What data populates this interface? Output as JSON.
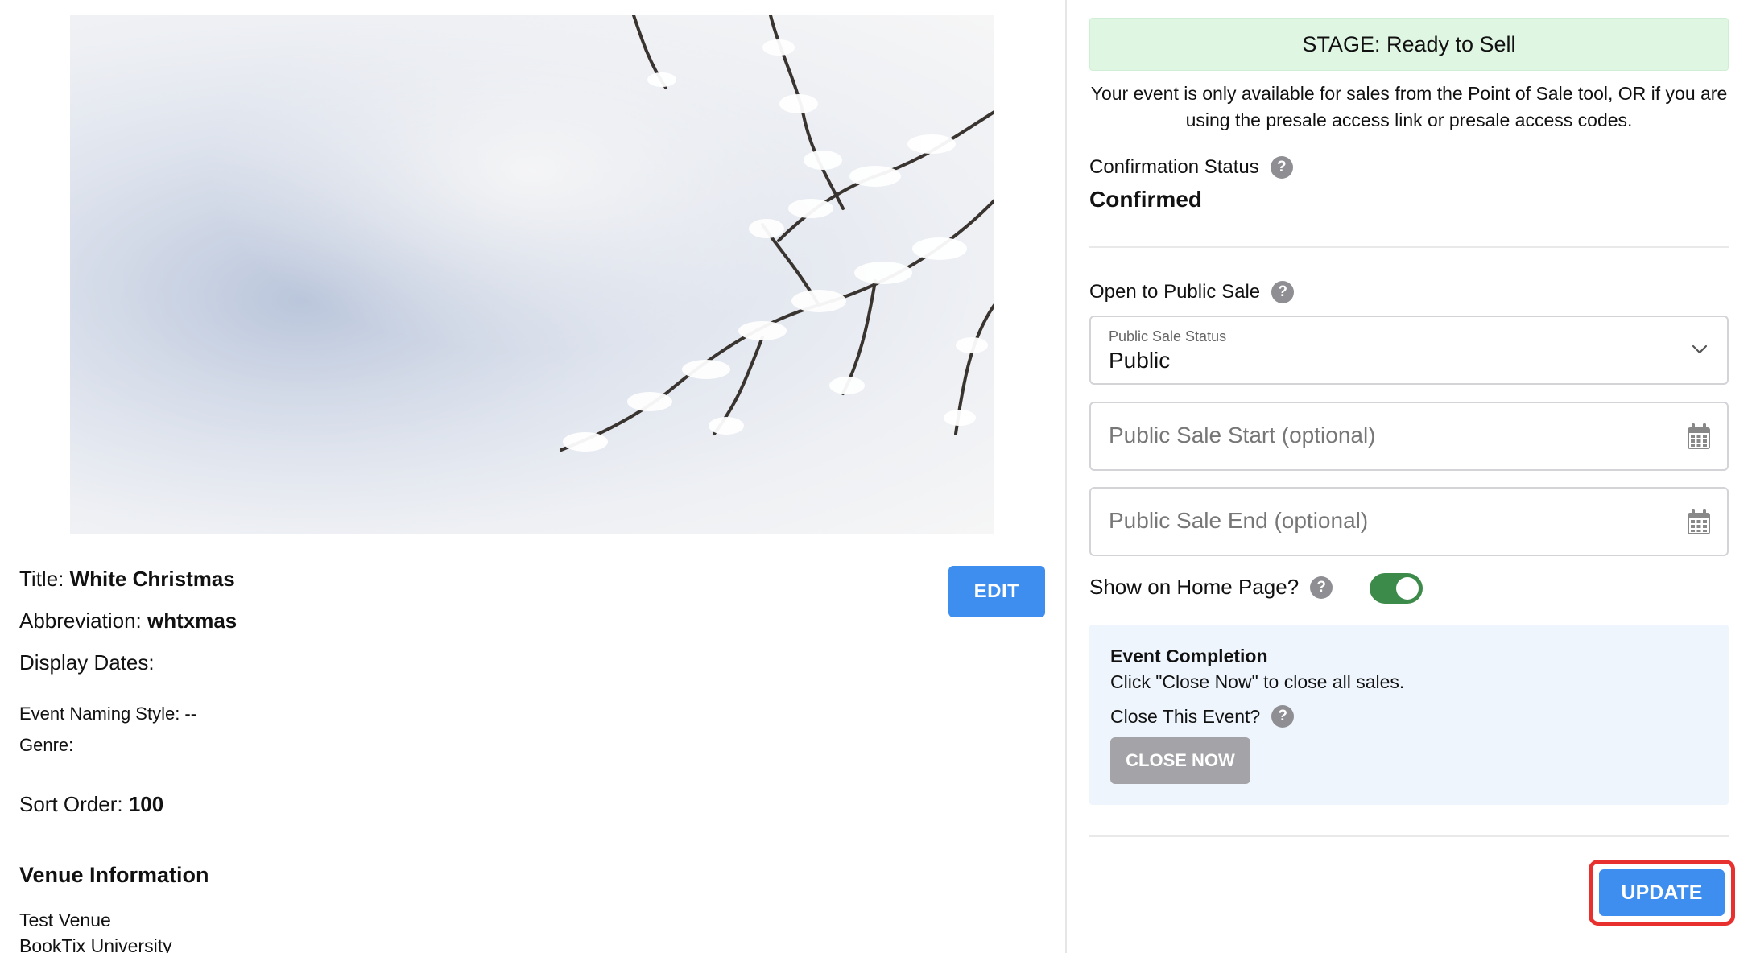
{
  "event": {
    "title_label": "Title:",
    "title": "White Christmas",
    "abbreviation_label": "Abbreviation:",
    "abbreviation": "whtxmas",
    "display_dates_label": "Display Dates:",
    "naming_style": "Event Naming Style: --",
    "genre": "Genre:",
    "sort_order_label": "Sort Order:",
    "sort_order": "100",
    "edit_label": "EDIT"
  },
  "venue": {
    "heading": "Venue Information",
    "name": "Test Venue",
    "org": "BookTix University"
  },
  "stage": {
    "banner": "STAGE: Ready to Sell",
    "description": "Your event is only available for sales from the Point of Sale tool, OR if you are using the presale access link or presale access codes."
  },
  "confirmation": {
    "label": "Confirmation Status",
    "value": "Confirmed"
  },
  "public_sale": {
    "label": "Open to Public Sale",
    "status_label": "Public Sale Status",
    "status_value": "Public",
    "start_placeholder": "Public Sale Start (optional)",
    "end_placeholder": "Public Sale End (optional)"
  },
  "home_page": {
    "label": "Show on Home Page?",
    "enabled": true
  },
  "completion": {
    "title": "Event Completion",
    "description": "Click \"Close Now\" to close all sales.",
    "close_label": "Close This Event?",
    "close_button": "CLOSE NOW"
  },
  "help_glyph": "?",
  "update_label": "UPDATE",
  "colors": {
    "primary": "#3e8ef0",
    "stage_bg": "#dff6e3",
    "toggle_on": "#3d8b4a",
    "highlight": "#e8312f",
    "completion_bg": "#eef5fd"
  }
}
